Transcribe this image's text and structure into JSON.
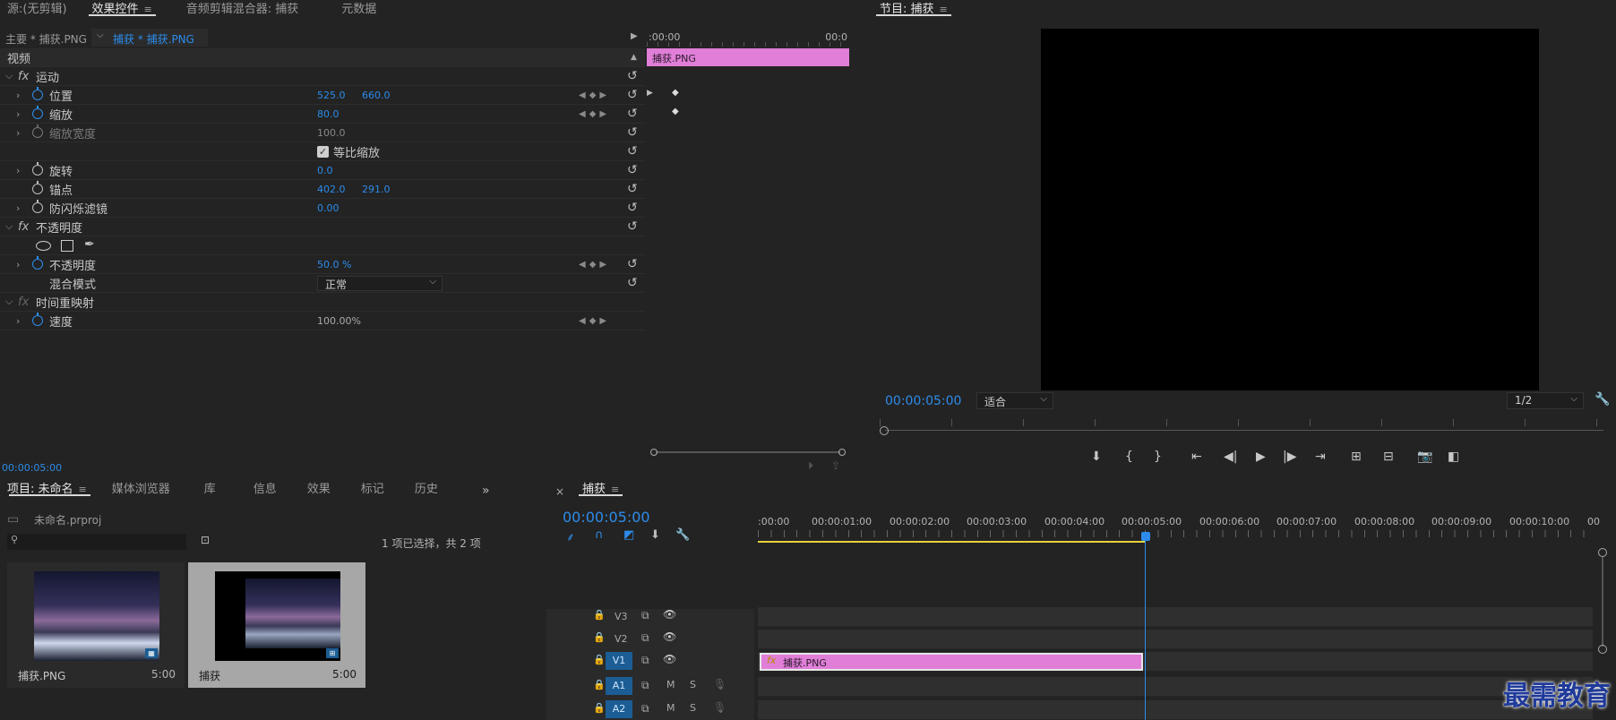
{
  "effect_controls": {
    "tabs": [
      "源:(无剪辑)",
      "效果控件",
      "音频剪辑混合器: 捕获",
      "元数据"
    ],
    "menu_glyph": "≡",
    "clip_master": "主要 * 捕获.PNG",
    "clip_active": "捕获 * 捕获.PNG",
    "timecode_start": ":00:00",
    "timecode_end": "00:0",
    "clip_bar_label": "捕获.PNG",
    "video_header": "视频",
    "fx_badge": "fx",
    "sections": {
      "motion": "运动",
      "opacity": "不透明度",
      "time_remap": "时间重映射"
    },
    "props": {
      "position": {
        "label": "位置",
        "x": "525.0",
        "y": "660.0"
      },
      "scale": {
        "label": "缩放",
        "value": "80.0"
      },
      "scale_width": {
        "label": "缩放宽度",
        "value": "100.0"
      },
      "uniform_scale": {
        "label": "等比缩放"
      },
      "rotation": {
        "label": "旋转",
        "value": "0.0"
      },
      "anchor": {
        "label": "锚点",
        "x": "402.0",
        "y": "291.0"
      },
      "flicker": {
        "label": "防闪烁滤镜",
        "value": "0.00"
      },
      "opacity": {
        "label": "不透明度",
        "value": "50.0 %"
      },
      "blend_mode": {
        "label": "混合模式",
        "value": "正常"
      },
      "speed": {
        "label": "速度",
        "value": "100.00%"
      }
    },
    "bottom_timecode": "00:00:05:00"
  },
  "program_monitor": {
    "title": "节目: 捕获",
    "timecode": "00:00:05:00",
    "fit": "适合",
    "resolution": "1/2"
  },
  "project": {
    "tabs": [
      "项目: 未命名",
      "媒体浏览器",
      "库",
      "信息",
      "效果",
      "标记",
      "历史"
    ],
    "project_file": "未命名.prproj",
    "selection_info": "1 项已选择，共 2 项",
    "items": [
      {
        "name": "捕获.PNG",
        "duration": "5:00"
      },
      {
        "name": "捕获",
        "duration": "5:00"
      }
    ]
  },
  "timeline": {
    "title": "捕获",
    "close": "×",
    "timecode": "00:00:05:00",
    "ruler": [
      ":00:00",
      "00:00:01:00",
      "00:00:02:00",
      "00:00:03:00",
      "00:00:04:00",
      "00:00:05:00",
      "00:00:06:00",
      "00:00:07:00",
      "00:00:08:00",
      "00:00:09:00",
      "00:00:10:00",
      "00"
    ],
    "tracks": [
      "V3",
      "V2",
      "V1",
      "A1",
      "A2"
    ],
    "mute": "M",
    "solo": "S",
    "clip_label": "捕获.PNG"
  },
  "watermark": "最需教育"
}
